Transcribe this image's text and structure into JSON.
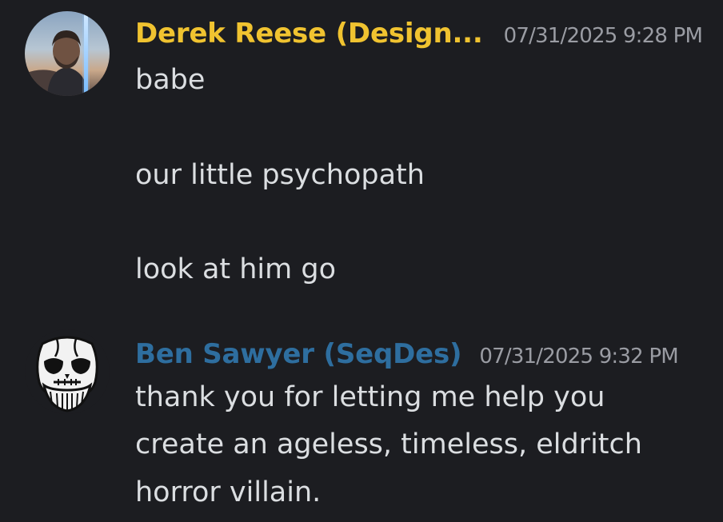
{
  "messages": [
    {
      "author": "Derek Reese (Design...",
      "timestamp": "07/31/2025 9:28 PM",
      "author_color": "#f0c330",
      "avatar": "profile-photo-avatar",
      "lines": [
        "babe",
        "our little psychopath",
        "look at him go"
      ]
    },
    {
      "author": "Ben Sawyer (SeqDes)",
      "timestamp": "07/31/2025 9:32 PM",
      "author_color": "#2e6e9f",
      "avatar": "skull-avatar",
      "lines": [
        "thank you for letting me help you",
        "create an ageless, timeless, eldritch",
        "horror villain."
      ]
    }
  ]
}
